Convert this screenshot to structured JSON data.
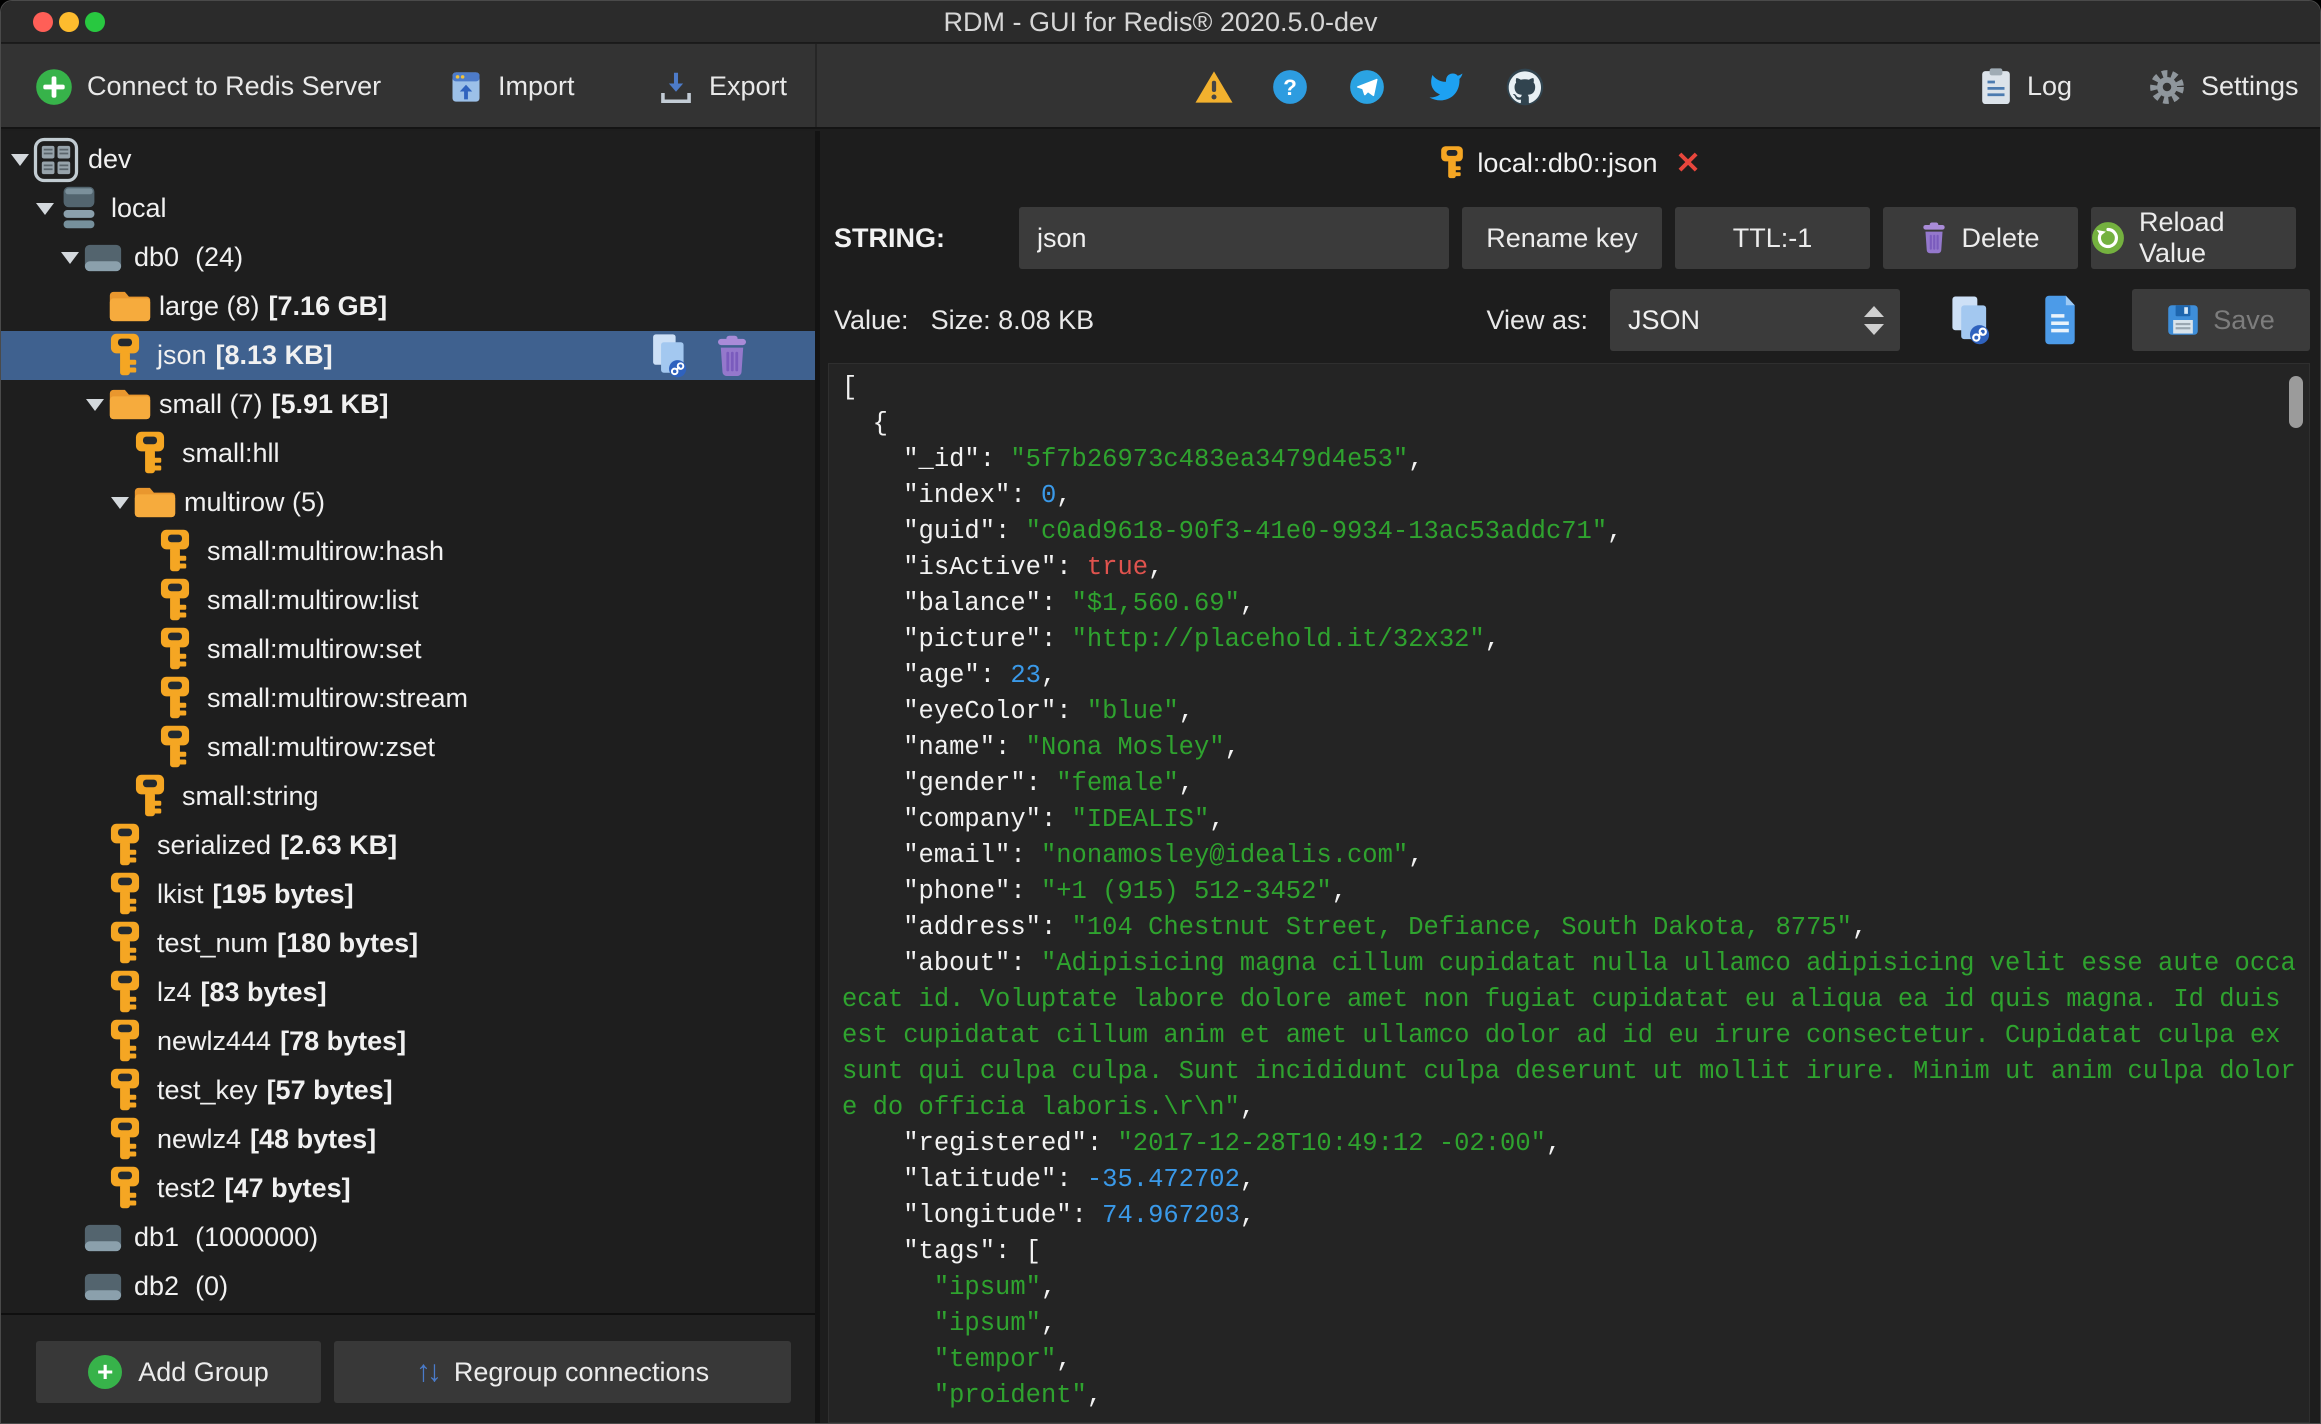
{
  "window": {
    "title": "RDM - GUI for Redis® 2020.5.0-dev"
  },
  "toolbar": {
    "connect_label": "Connect to Redis Server",
    "import_label": "Import",
    "export_label": "Export",
    "log_label": "Log",
    "settings_label": "Settings"
  },
  "sidebar": {
    "tree": [
      {
        "level": 0,
        "icon": "grid",
        "arrow": true,
        "name": "dev"
      },
      {
        "level": 1,
        "icon": "stack",
        "arrow": true,
        "name": "local"
      },
      {
        "level": 2,
        "icon": "disk",
        "arrow": true,
        "name": "db0",
        "count": "(24)"
      },
      {
        "level": 3,
        "icon": "folder",
        "arrow": false,
        "name": "large (8)",
        "size": "[7.16 GB]"
      },
      {
        "level": 3,
        "icon": "key",
        "arrow": false,
        "name": "json",
        "size": "[8.13 KB]",
        "selected": true,
        "actions": true
      },
      {
        "level": 3,
        "icon": "folder",
        "arrow": true,
        "name": "small (7)",
        "size": "[5.91 KB]"
      },
      {
        "level": 4,
        "icon": "key",
        "arrow": false,
        "name": "small:hll"
      },
      {
        "level": 4,
        "icon": "folder",
        "arrow": true,
        "name": "multirow (5)"
      },
      {
        "level": 5,
        "icon": "key",
        "arrow": false,
        "name": "small:multirow:hash"
      },
      {
        "level": 5,
        "icon": "key",
        "arrow": false,
        "name": "small:multirow:list"
      },
      {
        "level": 5,
        "icon": "key",
        "arrow": false,
        "name": "small:multirow:set"
      },
      {
        "level": 5,
        "icon": "key",
        "arrow": false,
        "name": "small:multirow:stream"
      },
      {
        "level": 5,
        "icon": "key",
        "arrow": false,
        "name": "small:multirow:zset"
      },
      {
        "level": 4,
        "icon": "key",
        "arrow": false,
        "name": "small:string"
      },
      {
        "level": 3,
        "icon": "key",
        "arrow": false,
        "name": "serialized",
        "size": "[2.63 KB]"
      },
      {
        "level": 3,
        "icon": "key",
        "arrow": false,
        "name": "lkist",
        "size": "[195 bytes]"
      },
      {
        "level": 3,
        "icon": "key",
        "arrow": false,
        "name": "test_num",
        "size": "[180 bytes]"
      },
      {
        "level": 3,
        "icon": "key",
        "arrow": false,
        "name": "lz4",
        "size": "[83 bytes]"
      },
      {
        "level": 3,
        "icon": "key",
        "arrow": false,
        "name": "newlz444",
        "size": "[78 bytes]"
      },
      {
        "level": 3,
        "icon": "key",
        "arrow": false,
        "name": "test_key",
        "size": "[57 bytes]"
      },
      {
        "level": 3,
        "icon": "key",
        "arrow": false,
        "name": "newlz4",
        "size": "[48 bytes]"
      },
      {
        "level": 3,
        "icon": "key",
        "arrow": false,
        "name": "test2",
        "size": "[47 bytes]"
      },
      {
        "level": 2,
        "icon": "disk",
        "arrow": false,
        "name": "db1",
        "count": "(1000000)"
      },
      {
        "level": 2,
        "icon": "disk",
        "arrow": false,
        "name": "db2",
        "count": "(0)"
      }
    ],
    "footer": {
      "add_group": "Add Group",
      "regroup": "Regroup connections"
    }
  },
  "tab": {
    "label": "local::db0::json",
    "close": "✕"
  },
  "key_editor": {
    "type_label": "STRING:",
    "key_name": "json",
    "rename_button": "Rename key",
    "ttl_button": "TTL:-1",
    "delete_button": "Delete",
    "reload_button": "Reload Value",
    "value_label": "Value:",
    "size_label": "Size: 8.08 KB",
    "view_as_label": "View as:",
    "view_as_value": "JSON",
    "save_button": "Save"
  },
  "editor": {
    "lines": [
      [
        [
          "p",
          "["
        ]
      ],
      [
        [
          "p",
          "  {"
        ]
      ],
      [
        [
          "p",
          "    "
        ],
        [
          "k",
          "\"_id\""
        ],
        [
          "p",
          ": "
        ],
        [
          "s",
          "\"5f7b26973c483ea3479d4e53\""
        ],
        [
          "p",
          ","
        ]
      ],
      [
        [
          "p",
          "    "
        ],
        [
          "k",
          "\"index\""
        ],
        [
          "p",
          ": "
        ],
        [
          "n",
          "0"
        ],
        [
          "p",
          ","
        ]
      ],
      [
        [
          "p",
          "    "
        ],
        [
          "k",
          "\"guid\""
        ],
        [
          "p",
          ": "
        ],
        [
          "s",
          "\"c0ad9618-90f3-41e0-9934-13ac53addc71\""
        ],
        [
          "p",
          ","
        ]
      ],
      [
        [
          "p",
          "    "
        ],
        [
          "k",
          "\"isActive\""
        ],
        [
          "p",
          ": "
        ],
        [
          "b",
          "true"
        ],
        [
          "p",
          ","
        ]
      ],
      [
        [
          "p",
          "    "
        ],
        [
          "k",
          "\"balance\""
        ],
        [
          "p",
          ": "
        ],
        [
          "s",
          "\"$1,560.69\""
        ],
        [
          "p",
          ","
        ]
      ],
      [
        [
          "p",
          "    "
        ],
        [
          "k",
          "\"picture\""
        ],
        [
          "p",
          ": "
        ],
        [
          "s",
          "\"http://placehold.it/32x32\""
        ],
        [
          "p",
          ","
        ]
      ],
      [
        [
          "p",
          "    "
        ],
        [
          "k",
          "\"age\""
        ],
        [
          "p",
          ": "
        ],
        [
          "n",
          "23"
        ],
        [
          "p",
          ","
        ]
      ],
      [
        [
          "p",
          "    "
        ],
        [
          "k",
          "\"eyeColor\""
        ],
        [
          "p",
          ": "
        ],
        [
          "s",
          "\"blue\""
        ],
        [
          "p",
          ","
        ]
      ],
      [
        [
          "p",
          "    "
        ],
        [
          "k",
          "\"name\""
        ],
        [
          "p",
          ": "
        ],
        [
          "s",
          "\"Nona Mosley\""
        ],
        [
          "p",
          ","
        ]
      ],
      [
        [
          "p",
          "    "
        ],
        [
          "k",
          "\"gender\""
        ],
        [
          "p",
          ": "
        ],
        [
          "s",
          "\"female\""
        ],
        [
          "p",
          ","
        ]
      ],
      [
        [
          "p",
          "    "
        ],
        [
          "k",
          "\"company\""
        ],
        [
          "p",
          ": "
        ],
        [
          "s",
          "\"IDEALIS\""
        ],
        [
          "p",
          ","
        ]
      ],
      [
        [
          "p",
          "    "
        ],
        [
          "k",
          "\"email\""
        ],
        [
          "p",
          ": "
        ],
        [
          "s",
          "\"nonamosley@idealis.com\""
        ],
        [
          "p",
          ","
        ]
      ],
      [
        [
          "p",
          "    "
        ],
        [
          "k",
          "\"phone\""
        ],
        [
          "p",
          ": "
        ],
        [
          "s",
          "\"+1 (915) 512-3452\""
        ],
        [
          "p",
          ","
        ]
      ],
      [
        [
          "p",
          "    "
        ],
        [
          "k",
          "\"address\""
        ],
        [
          "p",
          ": "
        ],
        [
          "s",
          "\"104 Chestnut Street, Defiance, South Dakota, 8775\""
        ],
        [
          "p",
          ","
        ]
      ],
      [
        [
          "p",
          "    "
        ],
        [
          "k",
          "\"about\""
        ],
        [
          "p",
          ": "
        ],
        [
          "s",
          "\"Adipisicing magna cillum cupidatat nulla ullamco adipisicing velit esse aute occa"
        ]
      ],
      [
        [
          "s",
          "ecat id. Voluptate labore dolore amet non fugiat cupidatat eu aliqua ea id quis magna. Id duis "
        ]
      ],
      [
        [
          "s",
          "est cupidatat cillum anim et amet ullamco dolor ad id eu irure consectetur. Cupidatat culpa ex "
        ]
      ],
      [
        [
          "s",
          "sunt qui culpa culpa. Sunt incididunt culpa deserunt ut mollit irure. Minim ut anim culpa dolor"
        ]
      ],
      [
        [
          "s",
          "e do officia laboris.\\r\\n\""
        ],
        [
          "p",
          ","
        ]
      ],
      [
        [
          "p",
          "    "
        ],
        [
          "k",
          "\"registered\""
        ],
        [
          "p",
          ": "
        ],
        [
          "s",
          "\"2017-12-28T10:49:12 -02:00\""
        ],
        [
          "p",
          ","
        ]
      ],
      [
        [
          "p",
          "    "
        ],
        [
          "k",
          "\"latitude\""
        ],
        [
          "p",
          ": "
        ],
        [
          "n",
          "-35.472702"
        ],
        [
          "p",
          ","
        ]
      ],
      [
        [
          "p",
          "    "
        ],
        [
          "k",
          "\"longitude\""
        ],
        [
          "p",
          ": "
        ],
        [
          "n",
          "74.967203"
        ],
        [
          "p",
          ","
        ]
      ],
      [
        [
          "p",
          "    "
        ],
        [
          "k",
          "\"tags\""
        ],
        [
          "p",
          ": ["
        ]
      ],
      [
        [
          "p",
          "      "
        ],
        [
          "s",
          "\"ipsum\""
        ],
        [
          "p",
          ","
        ]
      ],
      [
        [
          "p",
          "      "
        ],
        [
          "s",
          "\"ipsum\""
        ],
        [
          "p",
          ","
        ]
      ],
      [
        [
          "p",
          "      "
        ],
        [
          "s",
          "\"tempor\""
        ],
        [
          "p",
          ","
        ]
      ],
      [
        [
          "p",
          "      "
        ],
        [
          "s",
          "\"proident\""
        ],
        [
          "p",
          ","
        ]
      ]
    ]
  },
  "colors": {
    "selection_blue": "#3f618f",
    "key_orange": "#f5a623",
    "folder_yellow": "#f3a439",
    "string_green": "#2fa32f",
    "number_blue": "#3a99e8",
    "bool_red": "#e0534e",
    "close_red": "#e8463c"
  }
}
